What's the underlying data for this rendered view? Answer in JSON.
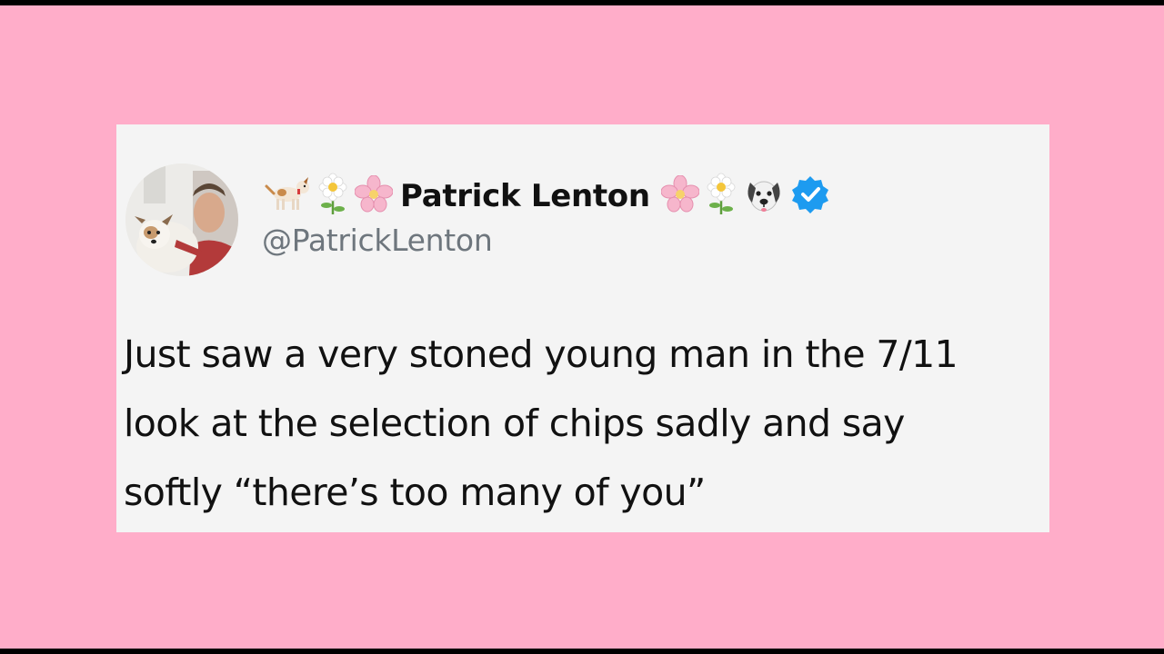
{
  "tweet": {
    "display_name": "Patrick Lenton",
    "handle": "@PatrickLenton",
    "verified": true,
    "name_prefix_icons": [
      "dog-icon",
      "daisy-icon",
      "cherry-blossom-icon"
    ],
    "name_suffix_icons": [
      "cherry-blossom-icon",
      "daisy-icon",
      "dog-face-icon",
      "verified-badge-icon"
    ],
    "text_lines": [
      "Just saw a very stoned young man in the 7/11",
      "look at the selection of chips sadly and say",
      "softly “there’s too many of you”"
    ]
  },
  "colors": {
    "background": "#ffadc9",
    "card": "#f4f4f4",
    "text": "#111111",
    "handle": "#6e767d",
    "verified": "#1d9bf0"
  }
}
